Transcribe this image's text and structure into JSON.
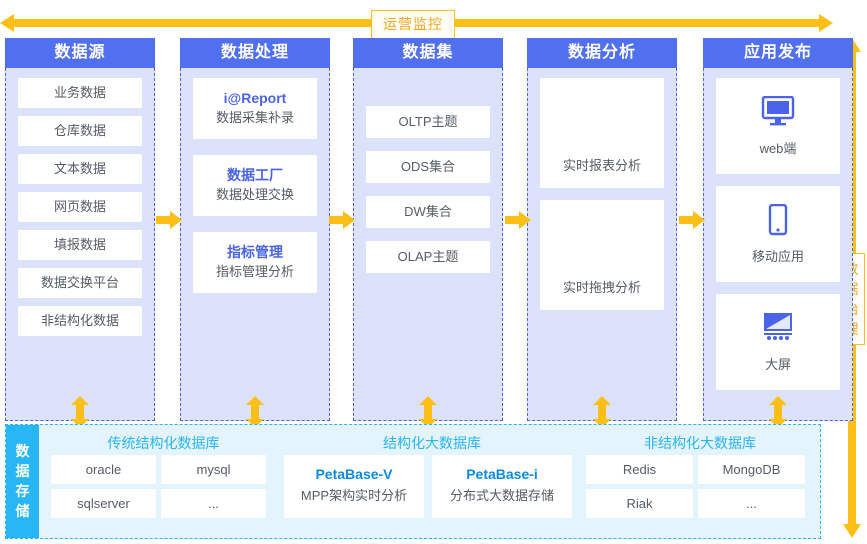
{
  "top_banner": {
    "label": "运营监控",
    "arrow": "double-headed-horizontal",
    "color": "#FCBF16"
  },
  "right_banner": {
    "label": "数据治理",
    "arrow": "double-headed-vertical",
    "color": "#FCBF16"
  },
  "columns": [
    {
      "title": "数据源",
      "type": "simple-list",
      "items": [
        {
          "label": "业务数据"
        },
        {
          "label": "仓库数据"
        },
        {
          "label": "文本数据"
        },
        {
          "label": "网页数据"
        },
        {
          "label": "填报数据"
        },
        {
          "label": "数据交换平台"
        },
        {
          "label": "非结构化数据"
        }
      ]
    },
    {
      "title": "数据处理",
      "type": "product-cards",
      "items": [
        {
          "title": "i@Report",
          "sub": "数据采集补录"
        },
        {
          "title": "数据工厂",
          "sub": "数据处理交换"
        },
        {
          "title": "指标管理",
          "sub": "指标管理分析"
        }
      ]
    },
    {
      "title": "数据集",
      "type": "simple-list",
      "items": [
        {
          "label": "OLTP主题"
        },
        {
          "label": "ODS集合"
        },
        {
          "label": "DW集合"
        },
        {
          "label": "OLAP主题"
        }
      ]
    },
    {
      "title": "数据分析",
      "type": "big-cards",
      "items": [
        {
          "label": "实时报表分析"
        },
        {
          "label": "实时拖拽分析"
        }
      ]
    },
    {
      "title": "应用发布",
      "type": "icon-cards",
      "items": [
        {
          "label": "web端",
          "icon": "monitor-icon"
        },
        {
          "label": "移动应用",
          "icon": "mobile-phone-icon"
        },
        {
          "label": "大屏",
          "icon": "big-screen-icon"
        }
      ]
    }
  ],
  "storage": {
    "label": "数据存储",
    "groups": [
      {
        "title": "传统结构化数据库",
        "kind": "cells",
        "cells": [
          "oracle",
          "mysql",
          "sqlserver",
          "..."
        ]
      },
      {
        "title": "结构化大数据库",
        "kind": "cards",
        "cards": [
          {
            "title": "PetaBase-V",
            "sub": "MPP架构实时分析"
          },
          {
            "title": "PetaBase-i",
            "sub": "分布式大数据存储"
          }
        ]
      },
      {
        "title": "非结构化大数据库",
        "kind": "cells",
        "cells": [
          "Redis",
          "MongoDB",
          "Riak",
          "..."
        ]
      }
    ]
  },
  "theme": {
    "header_blue": "#5170F0",
    "column_bg": "#DDE2FB",
    "arrow_yellow": "#FCBF16",
    "storage_cyan": "#29B6F6",
    "storage_bg": "#E3F4FC",
    "accent_text": "#4A63E7"
  }
}
